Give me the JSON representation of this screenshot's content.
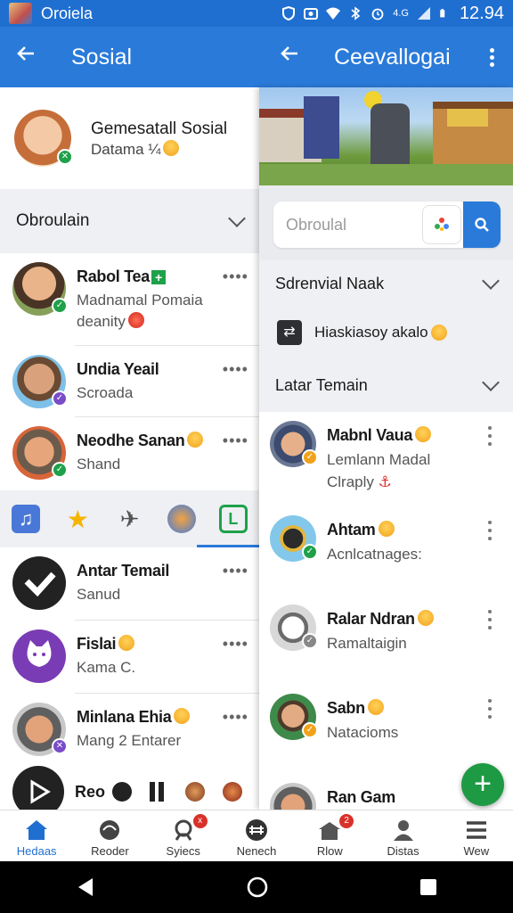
{
  "status_bar": {
    "app_name": "Oroiela",
    "signal_text": "4.G",
    "time": "12.94"
  },
  "header": {
    "left_title": "Sosial",
    "right_title": "Ceevallogai"
  },
  "left_panel": {
    "profile": {
      "name": "Gemesatall Sosial",
      "subtitle": "Datama ¼"
    },
    "section_title": "Obroulain",
    "contacts": [
      {
        "name": "Rabol Tea",
        "line1": "Madnamal Pomaia",
        "line2": "deanity"
      },
      {
        "name": "Undia Yeail",
        "line1": "Scroada"
      },
      {
        "name": "Neodhe Sanan",
        "line1": "Shand"
      }
    ],
    "tab_icons": [
      "music-icon",
      "star-icon",
      "plane-icon",
      "mascot-icon",
      "book-icon"
    ],
    "chats": [
      {
        "name": "Antar Temail",
        "line1": "Sanud"
      },
      {
        "name": "Fislai",
        "line1": "Kama C."
      },
      {
        "name": "Minlana Ehia",
        "line1": "Mang 2 Entarer"
      }
    ],
    "player": {
      "name": "Reo"
    }
  },
  "right_panel": {
    "search": {
      "placeholder": "Obroulal"
    },
    "section1": "Sdrenvial Naak",
    "menu_item": "Hiaskiasoy akalo",
    "section2": "Latar Temain",
    "people": [
      {
        "name": "Mabnl Vaua",
        "line1": "Lemlann Madal",
        "line2": "Clraply"
      },
      {
        "name": "Ahtam",
        "line1": "Acnlcatnages:"
      },
      {
        "name": "Ralar Ndran",
        "line1": "Ramaltaigin"
      },
      {
        "name": "Sabn",
        "line1": "Natacioms"
      },
      {
        "name": "Ran Gam",
        "line1": ""
      }
    ],
    "fab": "+"
  },
  "bottom_nav": [
    {
      "label": "Hedaas",
      "icon": "home-icon"
    },
    {
      "label": "Reoder",
      "icon": "reader-icon"
    },
    {
      "label": "Syiecs",
      "icon": "character-icon",
      "badge": "x"
    },
    {
      "label": "Nenech",
      "icon": "network-icon"
    },
    {
      "label": "Rlow",
      "icon": "house-icon",
      "badge": "2"
    },
    {
      "label": "Distas",
      "icon": "person-icon"
    },
    {
      "label": "Wew",
      "icon": "menu-icon"
    }
  ],
  "colors": {
    "primary": "#2a7ad9",
    "status_bar": "#1f6fd1",
    "fab": "#1e9a44",
    "badge_red": "#d9302a"
  }
}
